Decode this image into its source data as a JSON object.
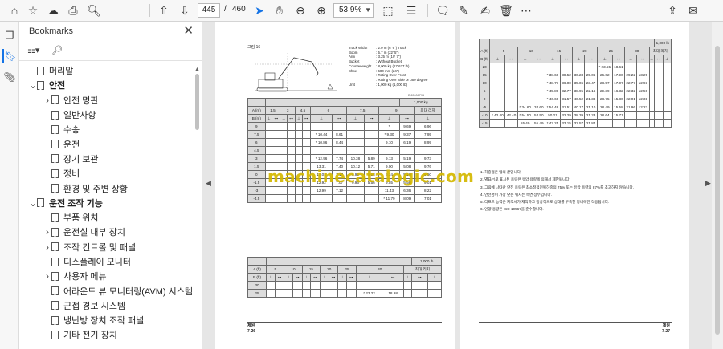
{
  "toolbar": {
    "page_current": "445",
    "page_separator": "/",
    "page_total": "460",
    "zoom": "53.9%",
    "icons": [
      "home-icon",
      "star-icon",
      "upload-cloud-icon",
      "print-icon",
      "zoom-search-icon",
      "page-up-icon",
      "page-down-icon",
      "select-cursor-icon",
      "hand-icon",
      "zoom-out-icon",
      "zoom-in-icon",
      "fit-page-icon",
      "scroll-mode-icon",
      "comment-icon",
      "highlight-pen-icon",
      "sign-icon",
      "delete-icon",
      "more-icon",
      "share-icon",
      "email-icon"
    ]
  },
  "sidebar": {
    "title": "Bookmarks",
    "items": [
      {
        "label": "머리말",
        "indent": 0,
        "toggle": ""
      },
      {
        "label": "안전",
        "indent": 0,
        "toggle": "v"
      },
      {
        "label": "안전 명판",
        "indent": 1,
        "toggle": ">"
      },
      {
        "label": "일반사항",
        "indent": 1,
        "toggle": ""
      },
      {
        "label": "수송",
        "indent": 1,
        "toggle": ""
      },
      {
        "label": "운전",
        "indent": 1,
        "toggle": ""
      },
      {
        "label": "장기 보관",
        "indent": 1,
        "toggle": ""
      },
      {
        "label": "정비",
        "indent": 1,
        "toggle": ""
      },
      {
        "label": "환경 및 주변 상황",
        "indent": 1,
        "toggle": "",
        "underline": true
      },
      {
        "label": "운전 조작 기능",
        "indent": 0,
        "toggle": "v"
      },
      {
        "label": "부품 위치",
        "indent": 1,
        "toggle": ""
      },
      {
        "label": "운전실 내부 장치",
        "indent": 1,
        "toggle": ">"
      },
      {
        "label": "조작 컨트롤 및 패널",
        "indent": 1,
        "toggle": ">"
      },
      {
        "label": "디스플레이 모니터",
        "indent": 1,
        "toggle": ""
      },
      {
        "label": "사용자 메뉴",
        "indent": 1,
        "toggle": ">"
      },
      {
        "label": "어라운드 뷰 모니터링(AVM) 시스템",
        "indent": 1,
        "toggle": ""
      },
      {
        "label": "근접 경보 시스템",
        "indent": 1,
        "toggle": ""
      },
      {
        "label": "냉난방 장치 조작 패널",
        "indent": 1,
        "toggle": ""
      },
      {
        "label": "기타 전기 장치",
        "indent": 1,
        "toggle": ""
      }
    ]
  },
  "left_page": {
    "figure_label": "그림 16",
    "specs": [
      {
        "k": "Track Width",
        "v": ": 2.0 m (6' 6\") Track"
      },
      {
        "k": "Boom",
        "v": ": 5.7 m (22' 5\")"
      },
      {
        "k": "Arm",
        "v": ": 3.25 m (10' 7\")"
      },
      {
        "k": "Bucket",
        "v": ": Without Bucket"
      },
      {
        "k": "Counterweight",
        "v": ": 8,000 kg (17,637 lb)"
      },
      {
        "k": "Shoe",
        "v": ": 600 mm (24\")"
      },
      {
        "k": "",
        "v": ": Rating Over Front"
      },
      {
        "k": "",
        "v": ": Rating Over Side or 360 degree"
      },
      {
        "k": "Unit",
        "v": ": 1,000 kg (1,000 lb)"
      }
    ],
    "diagram_code": "DS0008795",
    "table1": {
      "unit": "1,000 kg",
      "header_a": "A (m)",
      "header_b": "B (m)",
      "header_max": "최대 리치",
      "cols": [
        "1.5",
        "3",
        "4.5",
        "6",
        "7.5",
        "9"
      ],
      "rows": [
        {
          "b": "9",
          "vals": [
            "",
            "",
            "",
            "",
            "",
            "",
            "",
            "",
            "",
            "",
            "*",
            "9.69",
            "6.96"
          ]
        },
        {
          "b": "7.5",
          "vals": [
            "",
            "",
            "",
            "",
            "",
            "",
            "* 10.44",
            "8.61",
            "",
            "",
            "* 9.30",
            "9.37",
            "7.95"
          ]
        },
        {
          "b": "6",
          "vals": [
            "",
            "",
            "",
            "",
            "",
            "",
            "* 10.86",
            "8.44",
            "",
            "",
            "9.10",
            "6.19",
            "8.99"
          ]
        },
        {
          "b": "4.5",
          "vals": [
            "",
            "",
            "",
            "",
            "",
            "",
            "",
            "",
            "",
            "",
            "",
            "",
            ""
          ]
        },
        {
          "b": "3",
          "vals": [
            "",
            "",
            "",
            "",
            "",
            "",
            "* 12.96",
            "7.74",
            "10.38",
            "5.89",
            "9.13",
            "5.19",
            "9.73"
          ]
        },
        {
          "b": "1.5",
          "vals": [
            "",
            "",
            "",
            "",
            "",
            "",
            "13.31",
            "7.40",
            "10.12",
            "5.71",
            "9.00",
            "5.08",
            "9.76"
          ]
        },
        {
          "b": "0",
          "vals": [
            "",
            "",
            "",
            "",
            "",
            "",
            "13.04",
            "7.17",
            "9.98",
            "5.58",
            "9.24",
            "5.18",
            "9.50"
          ]
        },
        {
          "b": "-1.5",
          "vals": [
            "",
            "",
            "",
            "",
            "",
            "",
            "12.92",
            "7.07",
            "9.96",
            "5.56",
            "9.55",
            "5.56",
            "9.01"
          ]
        },
        {
          "b": "-3",
          "vals": [
            "",
            "",
            "",
            "",
            "",
            "",
            "12.99",
            "7.12",
            "",
            "",
            "11.43",
            "6.36",
            "8.22"
          ]
        },
        {
          "b": "-4.5",
          "vals": [
            "",
            "",
            "",
            "",
            "",
            "",
            "",
            "",
            "",
            "",
            "* 11.79",
            "8.09",
            "7.01"
          ]
        }
      ]
    },
    "table2": {
      "unit": "1,000 lb",
      "header_a": "A (ft)",
      "header_b": "B (ft)",
      "header_max": "최대 리치",
      "cols": [
        "5",
        "10",
        "15",
        "20",
        "25",
        "30"
      ],
      "rows": [
        {
          "b": "30",
          "vals": [
            "",
            "",
            "",
            "",
            "",
            "",
            "",
            "",
            "",
            "",
            "",
            "",
            "",
            "",
            ""
          ]
        },
        {
          "b": "25",
          "vals": [
            "",
            "",
            "",
            "",
            "",
            "",
            "",
            "",
            "",
            "",
            "* 23.22",
            "18.98",
            "",
            "",
            ""
          ]
        }
      ]
    },
    "footer_title": "제원",
    "footer_page": "7-26"
  },
  "right_page": {
    "table": {
      "unit": "1,000 lb",
      "header_a": "A (ft)",
      "header_b": "B (ft)",
      "header_max": "최대 리치",
      "cols": [
        "5",
        "10",
        "15",
        "20",
        "25",
        "30"
      ],
      "rows": [
        {
          "b": "20",
          "vals": [
            "",
            "",
            "",
            "",
            "",
            "",
            "",
            "",
            "* 23.55",
            "18.61",
            "",
            "",
            "",
            "",
            ""
          ]
        },
        {
          "b": "15",
          "vals": [
            "",
            "",
            "",
            "",
            "* 38.68",
            "38.52",
            "30.23",
            "25.06",
            "26.02",
            "17.90",
            "29.22",
            "13.29",
            "",
            "",
            ""
          ]
        },
        {
          "b": "10",
          "vals": [
            "",
            "",
            "",
            "",
            "* 48.77",
            "36.00",
            "35.06",
            "23.47",
            "28.57",
            "17.07",
            "22.77",
            "12.93",
            "",
            "",
            ""
          ]
        },
        {
          "b": "5",
          "vals": [
            "",
            "",
            "",
            "",
            "* 45.89",
            "32.77",
            "38.95",
            "22.16",
            "29.39",
            "16.32",
            "22.32",
            "12.59",
            "",
            "",
            ""
          ]
        },
        {
          "b": "0",
          "vals": [
            "",
            "",
            "",
            "",
            "* 46.60",
            "31.57",
            "40.52",
            "21.38",
            "28.75",
            "15.80",
            "22.01",
            "12.31",
            "",
            "",
            ""
          ]
        },
        {
          "b": "-5",
          "vals": [
            "",
            "",
            "* 34.60",
            "34.60",
            "* 54.48",
            "31.51",
            "40.17",
            "21.10",
            "28.49",
            "15.58",
            "21.96",
            "12.27",
            "",
            "",
            ""
          ]
        },
        {
          "b": "-10",
          "vals": [
            "* 42.40",
            "42.40",
            "* 54.50",
            "54.50",
            "50.21",
            "32.29",
            "38.39",
            "21.23",
            "28.64",
            "15.71",
            "",
            "",
            "",
            "",
            ""
          ]
        },
        {
          "b": "-15",
          "vals": [
            "",
            "",
            "55.49",
            "55.49",
            "* 42.25",
            "33.15",
            "32.57",
            "21.84",
            "",
            "",
            "",
            "",
            "",
            "",
            ""
          ]
        }
      ]
    },
    "notes": [
      "1. 하중점은 암의 끝입니다.",
      "2. 별표(*)로 표시된 용량은 유압 용량에 의해서 제한됩니다.",
      "3. 그림에 나타난 안전 용량은 최소정적전복하중의 75% 또는 유압 용량의 87%를 초과하지 않습니다.",
      "4. 안전성이 가장 낮은 위치는 측면 상부입니다.",
      "5. 리프트 능력은 제조사가 제작하고 정상적으로 상태를 구축한 장비에만 적용됩니다.",
      "6. 인양 용량은 ISO 10567을 준수합니다."
    ],
    "footer_title": "제원",
    "footer_page": "7-27"
  },
  "watermark": "machinecatalogic.com"
}
